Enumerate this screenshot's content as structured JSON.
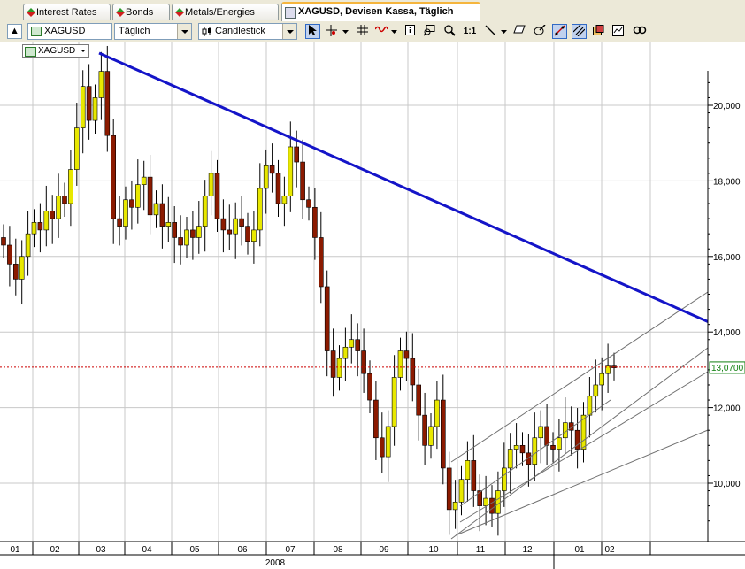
{
  "tabs": [
    {
      "label": "Interest Rates"
    },
    {
      "label": "Bonds"
    },
    {
      "label": "Metals/Energies"
    },
    {
      "label": "XAGUSD, Devisen Kassa, Täglich"
    }
  ],
  "toolbar": {
    "symbol": "XAGUSD",
    "interval": "Täglich",
    "chart_style": "Candlestick",
    "zoom_label": "1:1"
  },
  "badge": {
    "symbol": "XAGUSD"
  },
  "colors": {
    "trendline": "#1414c8",
    "last_price_line": "#cc0000",
    "last_price_label": "#108010",
    "bull_body": "#e8e800",
    "bear_body": "#8b1a00",
    "channel": "#707070"
  },
  "chart_data": {
    "type": "candlestick",
    "y_ticks": [
      "20,000",
      "18,000",
      "16,000",
      "14,000",
      "12,000",
      "10,000"
    ],
    "y_tick_values": [
      20,
      18,
      16,
      14,
      12,
      10
    ],
    "last_price_label": "13,0700",
    "last_price": 13.07,
    "x_month_labels": [
      "01",
      "02",
      "03",
      "04",
      "05",
      "06",
      "07",
      "08",
      "09",
      "10",
      "11",
      "12",
      "01",
      "02"
    ],
    "year_label": "2008",
    "closes": [
      16.3,
      15.8,
      15.4,
      16.0,
      16.6,
      16.9,
      16.7,
      17.2,
      17.0,
      17.6,
      17.4,
      18.3,
      19.4,
      20.5,
      19.6,
      20.2,
      20.9,
      19.2,
      17.0,
      16.8,
      17.5,
      17.3,
      17.9,
      18.1,
      17.1,
      17.4,
      16.8,
      16.9,
      16.5,
      16.3,
      16.7,
      16.5,
      16.8,
      17.6,
      18.2,
      17.0,
      16.7,
      16.6,
      17.0,
      16.8,
      16.4,
      16.7,
      17.8,
      18.4,
      18.2,
      17.4,
      17.6,
      18.9,
      18.5,
      17.5,
      17.3,
      16.5,
      15.2,
      13.5,
      12.8,
      13.3,
      13.6,
      13.8,
      13.5,
      12.9,
      12.2,
      11.2,
      10.7,
      11.5,
      12.8,
      13.5,
      13.3,
      12.6,
      11.8,
      11.0,
      11.5,
      12.2,
      10.4,
      9.3,
      9.5,
      10.1,
      10.6,
      9.8,
      9.4,
      9.6,
      9.2,
      9.8,
      10.4,
      10.9,
      11.0,
      10.8,
      10.5,
      11.2,
      11.5,
      11.0,
      10.9,
      11.2,
      11.6,
      11.4,
      10.9,
      11.8,
      12.3,
      12.6,
      12.9,
      13.1,
      13.07
    ],
    "trendline_label": ""
  }
}
